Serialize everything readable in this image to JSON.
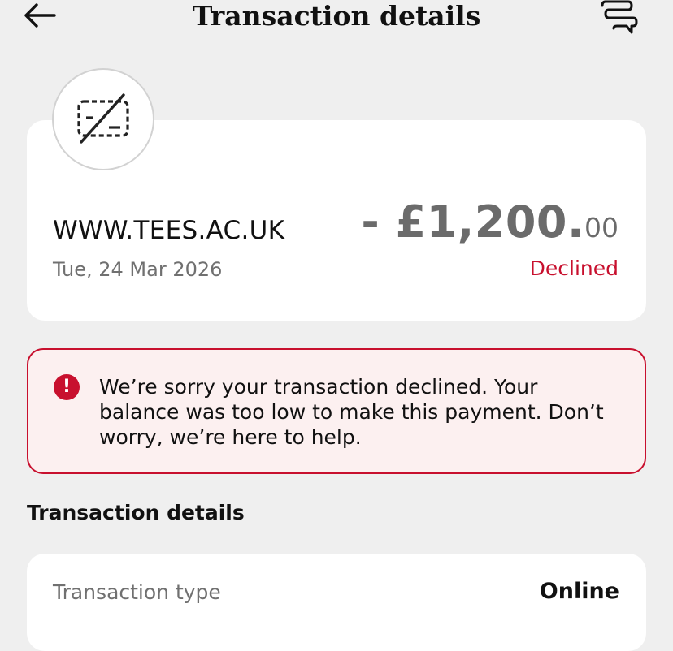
{
  "header": {
    "title": "Transaction details",
    "back_icon": "arrow-left-icon",
    "chat_icon": "chat-bubbles-icon"
  },
  "merchant": {
    "icon": "card-not-present-icon",
    "name": "WWW.TEES.AC.UK",
    "date": "Tue, 24 Mar 2026",
    "amount_main": "- £1,200.",
    "amount_decimal": "00",
    "status": "Declined"
  },
  "alert": {
    "icon": "exclamation-circle-icon",
    "message": "We’re sorry your transaction declined. Your balance was too low to make this payment. Don’t worry, we’re here to help."
  },
  "details": {
    "section_title": "Transaction details",
    "rows": [
      {
        "label": "Transaction type",
        "value": "Online"
      }
    ]
  },
  "colors": {
    "background": "#efefef",
    "card": "#ffffff",
    "declined": "#c8102e",
    "alert_background": "#fcf0f0",
    "muted_text": "#707070",
    "amount_text": "#6b6b6b"
  }
}
